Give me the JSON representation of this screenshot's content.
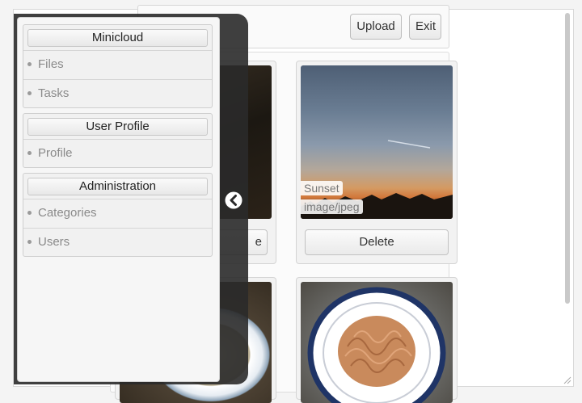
{
  "toolbar": {
    "upload_label": "Upload",
    "exit_label": "Exit"
  },
  "gallery": {
    "cards": [
      {
        "title": "",
        "type": "",
        "delete_label": "e"
      },
      {
        "title": "Sunset",
        "type": "image/jpeg",
        "delete_label": "Delete"
      }
    ]
  },
  "sidebar": {
    "groups": [
      {
        "title": "Minicloud",
        "items": [
          {
            "label": "Files"
          },
          {
            "label": "Tasks"
          }
        ]
      },
      {
        "title": "User Profile",
        "items": [
          {
            "label": "Profile"
          }
        ]
      },
      {
        "title": "Administration",
        "items": [
          {
            "label": "Categories"
          },
          {
            "label": "Users"
          }
        ]
      }
    ],
    "collapse_icon": "chevron-left-circle-icon"
  },
  "colors": {
    "panel_shade": "#2a2a2a",
    "nav_text": "#8a8a8a"
  }
}
